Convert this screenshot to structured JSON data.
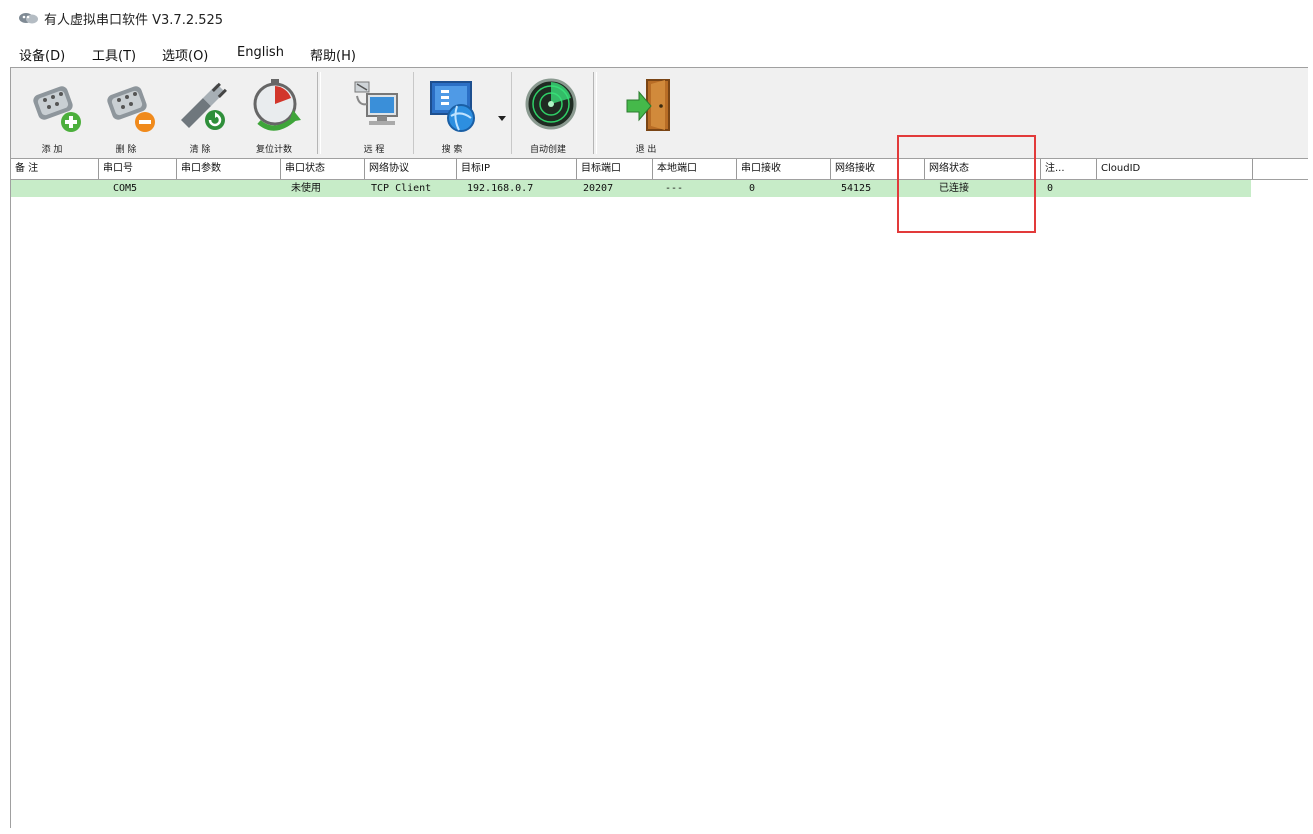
{
  "window": {
    "title": "有人虚拟串口软件 V3.7.2.525",
    "icon": "app-logo-icon"
  },
  "menu": {
    "items": [
      {
        "label": "设备(D)"
      },
      {
        "label": "工具(T)"
      },
      {
        "label": "选项(O)"
      },
      {
        "label": "English"
      },
      {
        "label": "帮助(H)"
      }
    ]
  },
  "toolbar": {
    "buttons": [
      {
        "label": "添 加",
        "icon": "serial-port-add-icon"
      },
      {
        "label": "删 除",
        "icon": "serial-port-remove-icon"
      },
      {
        "label": "清 除",
        "icon": "plug-clear-icon"
      },
      {
        "label": "复位计数",
        "icon": "timer-reset-icon"
      },
      {
        "label": "远 程",
        "icon": "remote-computer-icon"
      },
      {
        "label": "搜 索",
        "icon": "globe-search-icon"
      },
      {
        "label": "自动创建",
        "icon": "radar-icon"
      },
      {
        "label": "退 出",
        "icon": "exit-door-icon"
      }
    ]
  },
  "table": {
    "columns": [
      "备 注",
      "串口号",
      "串口参数",
      "串口状态",
      "网络协议",
      "目标IP",
      "目标端口",
      "本地端口",
      "串口接收",
      "网络接收",
      "网络状态",
      "注...",
      "CloudID"
    ],
    "rows": [
      {
        "note": "",
        "port": "COM5",
        "params": "",
        "port_status": "未使用",
        "protocol": "TCP Client",
        "target_ip": "192.168.0.7",
        "target_port": "20207",
        "local_port": "---",
        "serial_rx": "0",
        "net_rx": "54125",
        "net_status": "已连接",
        "reg": "0",
        "cloud_id": ""
      }
    ]
  },
  "colors": {
    "row_highlight": "#c7ecc8",
    "annotation_box": "#e23a3a",
    "toolbar_bg": "#f0f0f0"
  }
}
